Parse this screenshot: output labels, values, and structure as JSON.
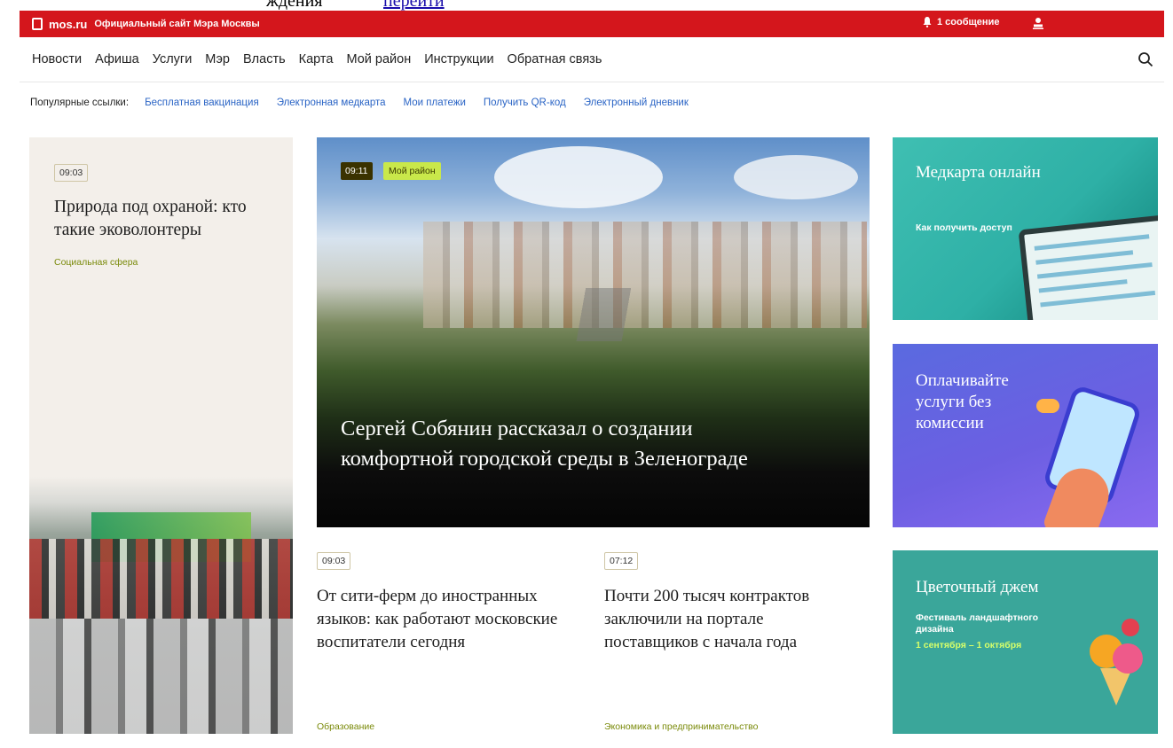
{
  "top_sliver": {
    "text": "ждения",
    "link": "перейти"
  },
  "topbar": {
    "brand": "mos.ru",
    "tagline": "Официальный сайт Мэра Москвы",
    "messages": "1 сообщение",
    "colors": {
      "bar": "#d4161c"
    }
  },
  "nav": {
    "items": [
      "Новости",
      "Афиша",
      "Услуги",
      "Мэр",
      "Власть",
      "Карта",
      "Мой район",
      "Инструкции",
      "Обратная связь"
    ]
  },
  "popular": {
    "label": "Популярные ссылки:",
    "links": [
      "Бесплатная вакцинация",
      "Электронная медкарта",
      "Мои платежи",
      "Получить QR-код",
      "Электронный дневник"
    ]
  },
  "left_card": {
    "time": "09:03",
    "title": "Природа под охраной: кто такие эковолонтеры",
    "category": "Социальная сфера"
  },
  "hero": {
    "time": "09:11",
    "category": "Мой район",
    "title": "Сергей Собянин рассказал о создании комфортной городской среды в Зеленограде"
  },
  "news": [
    {
      "time": "09:03",
      "title": "От сити-ферм до иностранных языков: как работают московские воспитатели сегодня",
      "category": "Образование"
    },
    {
      "time": "07:12",
      "title": "Почти 200 тысяч контрактов заключили на портале поставщиков с начала года",
      "category": "Экономика и предпринимательство"
    }
  ],
  "promos": [
    {
      "title": "Медкарта онлайн",
      "subtitle": "Как получить доступ"
    },
    {
      "title": "Оплачивайте услуги без комиссии"
    },
    {
      "title": "Цветочный джем",
      "subtitle": "Фестиваль ландшафтного дизайна",
      "date": "1 сентября – 1 октября"
    }
  ]
}
